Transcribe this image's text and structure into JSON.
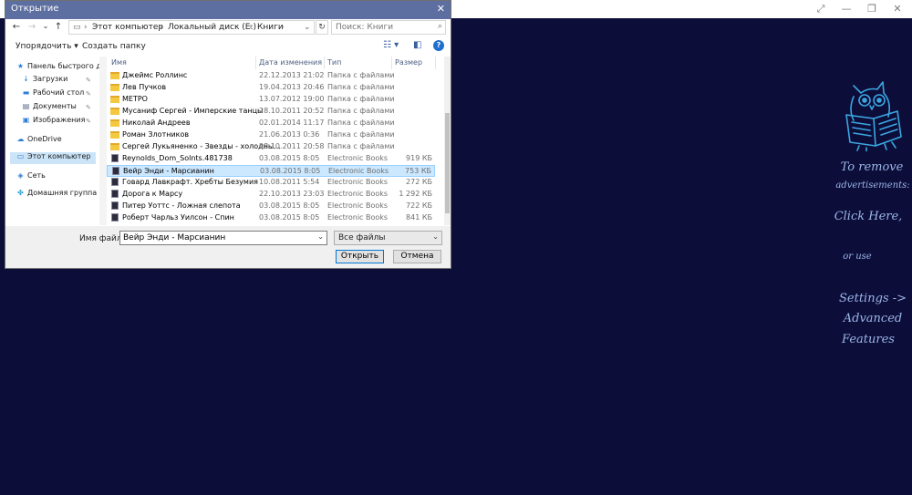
{
  "app": {
    "window_controls": [
      "⤢",
      "—",
      "❐",
      "✕"
    ],
    "ad": {
      "line1": "To remove",
      "line2": "advertisements:",
      "line3": "Click Here,",
      "line4": "or use",
      "line5": "Settings ->",
      "line6": "Advanced",
      "line7": "Features"
    }
  },
  "dialog": {
    "title": "Открытие",
    "close": "✕",
    "nav": {
      "back": "←",
      "forward": "→",
      "dropdown": "⌄",
      "up": "↑"
    },
    "breadcrumb": [
      "Этот компьютер",
      "Локальный диск (E:)",
      "Книги"
    ],
    "breadcrumb_sep": "›",
    "refresh": "↻",
    "search_placeholder": "Поиск: Книги",
    "toolbar": {
      "organize": "Упорядочить ▾",
      "new_folder": "Создать папку",
      "view": "☷ ▾",
      "pane": "◧",
      "help": "?"
    },
    "navpane": {
      "items": [
        {
          "label": "Панель быстрого до",
          "icon": "★",
          "icon_name": "star-icon"
        },
        {
          "label": "Загрузки",
          "icon": "↓",
          "icon_name": "downloads-icon"
        },
        {
          "label": "Рабочий стол",
          "icon": "▬",
          "icon_name": "desktop-icon"
        },
        {
          "label": "Документы",
          "icon": "▤",
          "icon_name": "documents-icon"
        },
        {
          "label": "Изображения",
          "icon": "▣",
          "icon_name": "pictures-icon"
        },
        {
          "label": "OneDrive",
          "icon": "☁",
          "icon_name": "onedrive-icon"
        },
        {
          "label": "Этот компьютер",
          "icon": "▭",
          "icon_name": "computer-icon"
        },
        {
          "label": "Сеть",
          "icon": "◈",
          "icon_name": "network-icon"
        },
        {
          "label": "Домашняя группа",
          "icon": "✤",
          "icon_name": "homegroup-icon"
        }
      ],
      "pin": "✎"
    },
    "columns": {
      "name": "Имя",
      "date": "Дата изменения",
      "type": "Тип",
      "size": "Размер"
    },
    "files": [
      {
        "name": "Джеймс Роллинс",
        "date": "22.12.2013 21:02",
        "type": "Папка с файлами",
        "size": "",
        "kind": "folder"
      },
      {
        "name": "Лев Пучков",
        "date": "19.04.2013 20:46",
        "type": "Папка с файлами",
        "size": "",
        "kind": "folder"
      },
      {
        "name": "МЕТРО",
        "date": "13.07.2012 19:00",
        "type": "Папка с файлами",
        "size": "",
        "kind": "folder"
      },
      {
        "name": "Мусаниф Сергей - Имперские танцы",
        "date": "28.10.2011 20:52",
        "type": "Папка с файлами",
        "size": "",
        "kind": "folder"
      },
      {
        "name": "Николай Андреев",
        "date": "02.01.2014 11:17",
        "type": "Папка с файлами",
        "size": "",
        "kind": "folder"
      },
      {
        "name": "Роман Злотников",
        "date": "21.06.2013 0:36",
        "type": "Папка с файлами",
        "size": "",
        "kind": "folder"
      },
      {
        "name": "Сергей Лукьяненко - Звезды - холодны...",
        "date": "28.10.2011 20:58",
        "type": "Папка с файлами",
        "size": "",
        "kind": "folder"
      },
      {
        "name": "Reynolds_Dom_Solnts.481738",
        "date": "03.08.2015 8:05",
        "type": "Electronic Books",
        "size": "919 КБ",
        "kind": "book"
      },
      {
        "name": "Вейр Энди - Марсианин",
        "date": "03.08.2015 8:05",
        "type": "Electronic Books",
        "size": "753 КБ",
        "kind": "book",
        "selected": true
      },
      {
        "name": "Говард Лавкрафт. Хребты Безумия",
        "date": "10.08.2011 5:54",
        "type": "Electronic Books",
        "size": "272 КБ",
        "kind": "book"
      },
      {
        "name": "Дорога к Марсу",
        "date": "22.10.2013 23:03",
        "type": "Electronic Books",
        "size": "1 292 КБ",
        "kind": "book"
      },
      {
        "name": "Питер Уоттс - Ложная слепота",
        "date": "03.08.2015 8:05",
        "type": "Electronic Books",
        "size": "722 КБ",
        "kind": "book"
      },
      {
        "name": "Роберт Чарльз Уилсон - Спин",
        "date": "03.08.2015 8:05",
        "type": "Electronic Books",
        "size": "841 КБ",
        "kind": "book"
      }
    ],
    "bottom": {
      "filename_label": "Имя файла:",
      "filename_value": "Вейр Энди - Марсианин",
      "filter_value": "Все файлы",
      "open_label": "Открыть",
      "cancel_label": "Отмена",
      "dropdown_arrow": "⌄"
    }
  }
}
